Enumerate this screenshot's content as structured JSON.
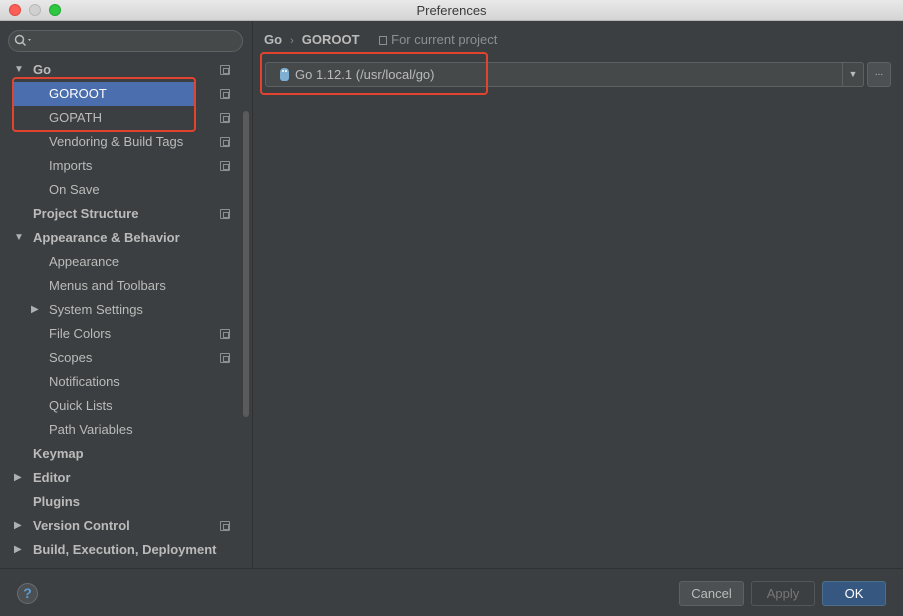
{
  "window": {
    "title": "Preferences"
  },
  "sidebar": {
    "search": {
      "value": "",
      "placeholder": ""
    },
    "items": [
      {
        "label": "Go",
        "level": 0,
        "bold": true,
        "expand": "expanded",
        "project_icon": true
      },
      {
        "label": "GOROOT",
        "level": 1,
        "bold": false,
        "expand": "none",
        "project_icon": true,
        "selected": true
      },
      {
        "label": "GOPATH",
        "level": 1,
        "bold": false,
        "expand": "none",
        "project_icon": true
      },
      {
        "label": "Vendoring & Build Tags",
        "level": 1,
        "bold": false,
        "expand": "none",
        "project_icon": true
      },
      {
        "label": "Imports",
        "level": 1,
        "bold": false,
        "expand": "none",
        "project_icon": true
      },
      {
        "label": "On Save",
        "level": 1,
        "bold": false,
        "expand": "none",
        "project_icon": false
      },
      {
        "label": "Project Structure",
        "level": 0,
        "bold": true,
        "expand": "none",
        "project_icon": true
      },
      {
        "label": "Appearance & Behavior",
        "level": 0,
        "bold": true,
        "expand": "expanded",
        "project_icon": false
      },
      {
        "label": "Appearance",
        "level": 1,
        "bold": false,
        "expand": "none",
        "project_icon": false
      },
      {
        "label": "Menus and Toolbars",
        "level": 1,
        "bold": false,
        "expand": "none",
        "project_icon": false
      },
      {
        "label": "System Settings",
        "level": 1,
        "bold": false,
        "expand": "collapsed",
        "project_icon": false
      },
      {
        "label": "File Colors",
        "level": 1,
        "bold": false,
        "expand": "none",
        "project_icon": true
      },
      {
        "label": "Scopes",
        "level": 1,
        "bold": false,
        "expand": "none",
        "project_icon": true
      },
      {
        "label": "Notifications",
        "level": 1,
        "bold": false,
        "expand": "none",
        "project_icon": false
      },
      {
        "label": "Quick Lists",
        "level": 1,
        "bold": false,
        "expand": "none",
        "project_icon": false
      },
      {
        "label": "Path Variables",
        "level": 1,
        "bold": false,
        "expand": "none",
        "project_icon": false
      },
      {
        "label": "Keymap",
        "level": 0,
        "bold": true,
        "expand": "none",
        "project_icon": false
      },
      {
        "label": "Editor",
        "level": 0,
        "bold": true,
        "expand": "collapsed",
        "project_icon": false
      },
      {
        "label": "Plugins",
        "level": 0,
        "bold": true,
        "expand": "none",
        "project_icon": false
      },
      {
        "label": "Version Control",
        "level": 0,
        "bold": true,
        "expand": "collapsed",
        "project_icon": true
      },
      {
        "label": "Build, Execution, Deployment",
        "level": 0,
        "bold": true,
        "expand": "collapsed",
        "project_icon": false
      }
    ]
  },
  "content": {
    "breadcrumb": [
      "Go",
      "GOROOT"
    ],
    "breadcrumb_separator": "›",
    "scope_label": "For current project",
    "sdk": {
      "name": "Go 1.12.1",
      "path": "(/usr/local/go)"
    },
    "browse_label": "...",
    "dropdown_glyph": "▼"
  },
  "footer": {
    "help_label": "?",
    "cancel_label": "Cancel",
    "apply_label": "Apply",
    "ok_label": "OK"
  },
  "icons": {
    "expanded": "▼",
    "collapsed": "▶"
  },
  "colors": {
    "background": "#3c3f41",
    "selection": "#4b6eaf",
    "highlight_box": "#e0442f",
    "ok_button": "#365880"
  }
}
